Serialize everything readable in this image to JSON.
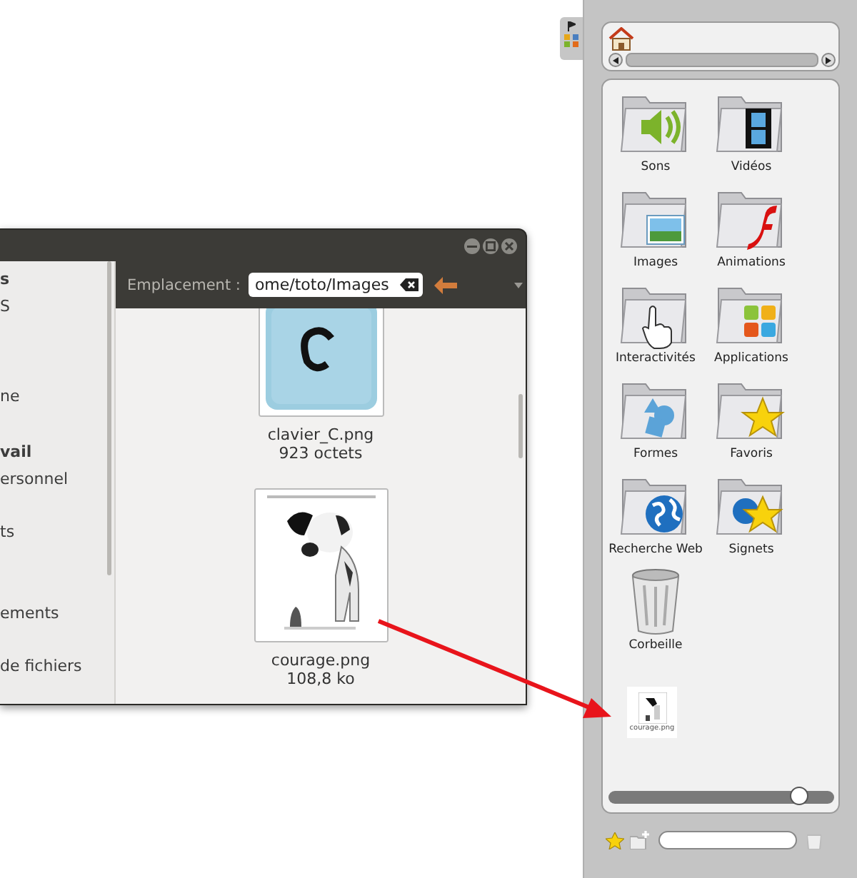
{
  "file_manager": {
    "location_label": "Emplacement :",
    "location_value": "ome/toto/Images",
    "sidebar_items": [
      {
        "label": "s",
        "bold": true
      },
      {
        "label": "S",
        "bold": false
      },
      {
        "label": "ne",
        "bold": false
      },
      {
        "label": "vail",
        "bold": true
      },
      {
        "label": "ersonnel",
        "bold": false
      },
      {
        "label": "ts",
        "bold": false
      },
      {
        "label": "ements",
        "bold": false
      },
      {
        "label": "de fichiers",
        "bold": false
      }
    ],
    "files": [
      {
        "kind": "key",
        "name": "clavier_C.png",
        "size": "923 octets"
      },
      {
        "kind": "picture",
        "name": "courage.png",
        "size": "108,8 ko"
      }
    ]
  },
  "panel": {
    "items": [
      {
        "kind": "sound",
        "label": "Sons"
      },
      {
        "kind": "video",
        "label": "Vidéos"
      },
      {
        "label": "Images"
      },
      {
        "kind": "flash",
        "label": "Animations"
      },
      {
        "kind": "pointer",
        "label": "Interactivités"
      },
      {
        "kind": "apps",
        "label": "Applications"
      },
      {
        "kind": "shapes",
        "label": "Formes"
      },
      {
        "kind": "star",
        "label": "Favoris"
      },
      {
        "kind": "globe",
        "label": "Recherche Web"
      },
      {
        "kind": "globe-star",
        "label": "Signets"
      },
      {
        "kind": "trash",
        "label": "Corbeille"
      }
    ],
    "dropped_file": {
      "name": "courage.png"
    },
    "zoom_slider": {
      "level": 0.84
    }
  }
}
